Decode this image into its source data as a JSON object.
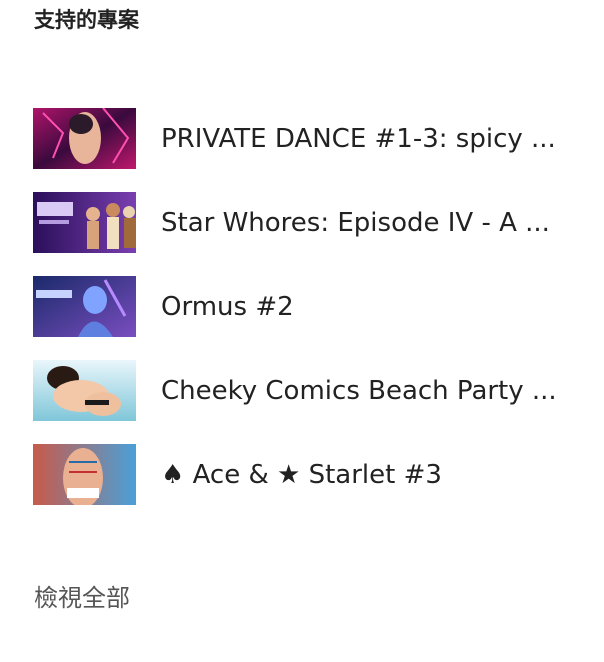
{
  "section": {
    "title": "支持的專案"
  },
  "projects": [
    {
      "title": "PRIVATE DANCE #1-3: spicy ...",
      "thumbnail": "artwork-thumbnail"
    },
    {
      "title": "Star Whores: Episode IV - A ...",
      "thumbnail": "artwork-thumbnail"
    },
    {
      "title": "Ormus #2",
      "thumbnail": "artwork-thumbnail"
    },
    {
      "title": "Cheeky Comics Beach Party ...",
      "thumbnail": "artwork-thumbnail"
    },
    {
      "title": "♠ Ace & ★ Starlet #3",
      "thumbnail": "artwork-thumbnail"
    }
  ],
  "footer": {
    "view_all": "檢視全部"
  }
}
